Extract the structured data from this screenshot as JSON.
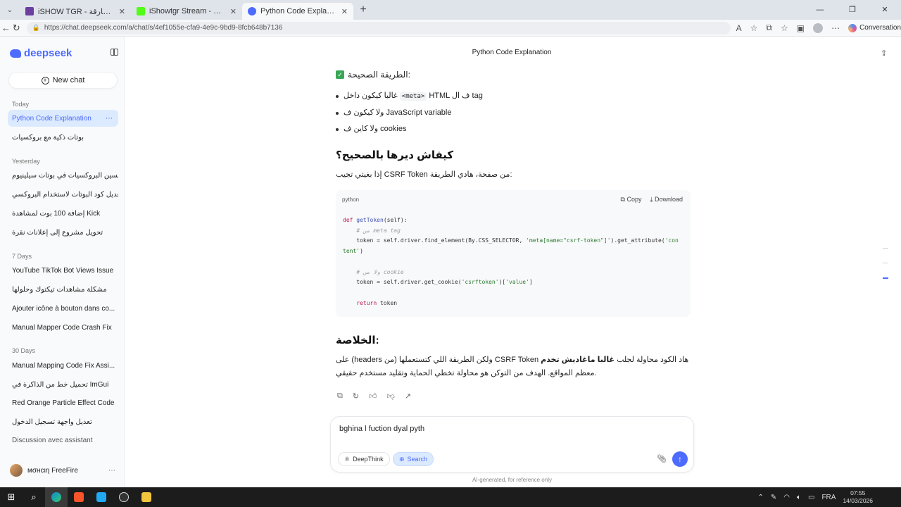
{
  "browser": {
    "tabs": [
      {
        "title": "iSHOW TGR - البوتات الخارقة",
        "active": false
      },
      {
        "title": "iShowtgr Stream - Watch Live on Kick",
        "active": false
      },
      {
        "title": "Python Code Explanation - DeepSeek",
        "active": true
      }
    ],
    "url": "https://chat.deepseek.com/a/chat/s/4ef1055e-cfa9-4e9c-9bd9-8fcb648b7136",
    "copilot_label": "Conversation"
  },
  "sidebar": {
    "brand": "deepseek",
    "new_chat": "New chat",
    "sections": [
      {
        "label": "Today",
        "items": [
          "Python Code Explanation",
          "بوتات ذكية مع بروكسيات"
        ]
      },
      {
        "label": "Yesterday",
        "items": [
          "تحسين البروكسيات في بوتات سيلينيوم",
          "تعديل كود البوتات لاستخدام البروكسي",
          "إضافة 100 بوت لمشاهدة Kick",
          "تحويل مشروع إلى إعلانات نقرة"
        ]
      },
      {
        "label": "7 Days",
        "items": [
          "YouTube TikTok Bot Views Issue",
          "مشكلة مشاهدات تيكتوك وحلولها",
          "Ajouter icône à bouton dans co...",
          "Manual Mapper Code Crash Fix"
        ]
      },
      {
        "label": "30 Days",
        "items": [
          "Manual Mapping Code Fix Assi...",
          "تحميل خط من الذاكرة في ImGui",
          "Red Orange Particle Effect Code",
          "تعديل واجهة تسجيل الدخول",
          "Discussion avec assistant"
        ]
      }
    ],
    "user_name": "мσнcιη FreeFire"
  },
  "chat": {
    "title": "Python Code Explanation",
    "correct_way_heading": "الطريقة الصحيحة:",
    "bullets": [
      {
        "before": "HTML ف ال tag",
        "code": "<meta>",
        "after": "غالبا كيكون داخل"
      },
      {
        "text": "ولا كيكون ف JavaScript variable"
      },
      {
        "text": "ولا كاين ف cookies"
      }
    ],
    "how_heading": "كيفاش ديرها بالصحيح؟",
    "how_text": "إذا بغيتي تجيب CSRF Token من صفحة، هادي الطريقة:",
    "code": {
      "lang": "python",
      "copy_label": "Copy",
      "download_label": "Download",
      "lines": [
        "def getToken(self):",
        "    # من meta tag",
        "    token = self.driver.find_element(By.CSS_SELECTOR, 'meta[name=\"csrf-token\"]').get_attribute('content')",
        "",
        "    # ولا من cookie",
        "    token = self.driver.get_cookie('csrftoken')['value']",
        "",
        "    return token"
      ]
    },
    "summary_heading": "الخلاصة:",
    "summary_bold": "غالبا ماغاديش تخدم",
    "summary_rest": "على (headers من) ولكن الطريقة اللي كتستعملها CSRF Token هاد الكود محاولة لجلب",
    "summary_line2": "معظم المواقع. الهدف من التوكن هو محاولة تخطي الحماية وتقليد مستخدم حقيقي.",
    "input_text": "bghina l fuction dyal pyth",
    "deepthink_label": "DeepThink",
    "search_label": "Search",
    "disclaimer": "AI-generated, for reference only"
  },
  "taskbar": {
    "lang": "FRA",
    "time": "07:55",
    "date": "14/03/2026"
  },
  "colors": {
    "accent": "#4d6bfe",
    "active_item_bg": "#dbeafe"
  }
}
